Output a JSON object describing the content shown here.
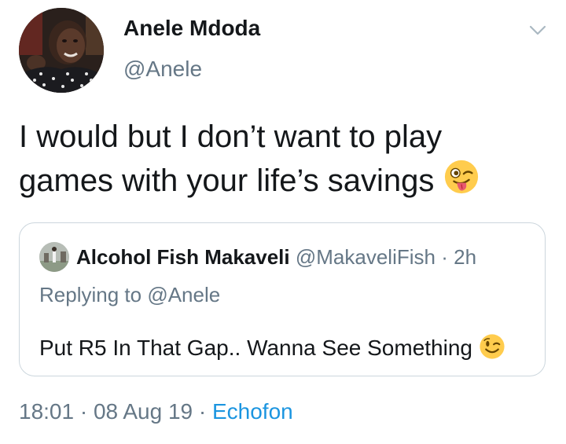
{
  "author": {
    "display_name": "Anele Mdoda",
    "handle": "@Anele"
  },
  "tweet": {
    "text_line1": "I would but I don’t want to play",
    "text_line2": "games with your life’s savings",
    "emoji_icon": "winking-face-with-tongue-icon"
  },
  "quoted_tweet": {
    "display_name": "Alcohol Fish Makaveli",
    "handle": "@MakaveliFish",
    "separator": "·",
    "time": "2h",
    "replying_prefix": "Replying to",
    "replying_to": "@Anele",
    "text": "Put R5 In That Gap.. Wanna See Something",
    "emoji_icon": "winking-face-icon"
  },
  "meta": {
    "time": "18:01",
    "separator1": "·",
    "date": "08 Aug 19",
    "separator2": "·",
    "source": "Echofon"
  },
  "colors": {
    "text": "#14171a",
    "secondary": "#657786",
    "link": "#1b95e0",
    "border": "#ccd6dd"
  },
  "menu_icon": "chevron-down-icon"
}
